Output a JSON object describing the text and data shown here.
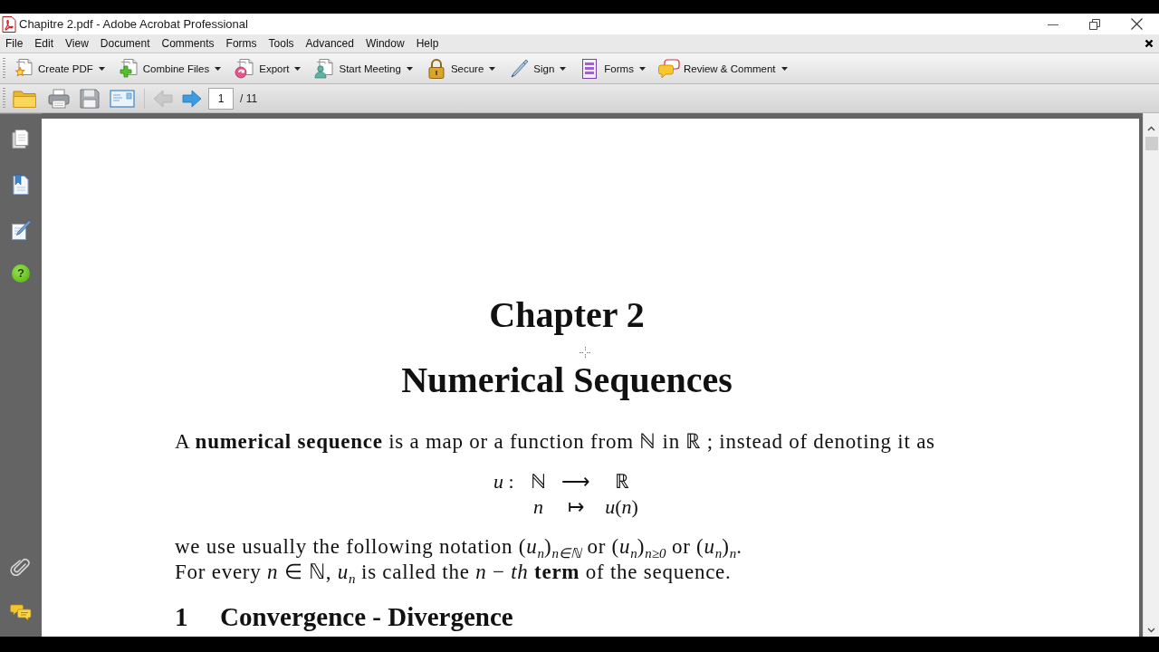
{
  "window": {
    "title": "Chapitre 2.pdf - Adobe Acrobat Professional"
  },
  "menu_bar": {
    "items": [
      "File",
      "Edit",
      "View",
      "Document",
      "Comments",
      "Forms",
      "Tools",
      "Advanced",
      "Window",
      "Help"
    ]
  },
  "tasks_toolbar": {
    "buttons": [
      {
        "kind": "create_pdf",
        "label": "Create PDF"
      },
      {
        "kind": "combine",
        "label": "Combine Files"
      },
      {
        "kind": "export",
        "label": "Export"
      },
      {
        "kind": "meeting",
        "label": "Start Meeting"
      },
      {
        "kind": "secure",
        "label": "Secure"
      },
      {
        "kind": "sign",
        "label": "Sign"
      },
      {
        "kind": "forms",
        "label": "Forms"
      },
      {
        "kind": "review",
        "label": "Review & Comment"
      }
    ]
  },
  "page_toolbar": {
    "file_buttons": [
      {
        "kind": "open"
      },
      {
        "kind": "print"
      },
      {
        "kind": "save"
      },
      {
        "kind": "email"
      }
    ],
    "page_buttons": [
      {
        "kind": "previous",
        "disabled": true
      },
      {
        "kind": "next",
        "disabled": false
      }
    ],
    "page_number": "1",
    "page_count": "/ 11"
  },
  "navigation_pane": {
    "top_buttons": [
      {
        "kind": "pages"
      },
      {
        "kind": "bookmarks"
      },
      {
        "kind": "signatures"
      },
      {
        "kind": "help",
        "glyph": "?"
      }
    ],
    "bottom_buttons": [
      {
        "kind": "attachments"
      },
      {
        "kind": "comments"
      }
    ]
  },
  "document": {
    "chapter": "Chapter 2",
    "title": "Numerical Sequences",
    "paragraph": "A **numerical sequence** is a map or a function from ℕ in ℝ ; instead of denoting it as",
    "mapping": {
      "name": "*u* :",
      "rows": [
        {
          "kind": "sets",
          "from": "ℕ",
          "arrow": "⟶",
          "to": "ℝ"
        },
        {
          "kind": "elements",
          "from": "n",
          "arrow": "↦",
          "to": "*u*(*n*)"
        }
      ]
    },
    "lines": [
      "we use usually the following notation (*u*$_{n}$)$_{n∈ℕ}$ or (*u*$_{n}$)$_{n≥0}$ or (*u*$_{n}$)$_{n}$.",
      "For every *n* ∈ ℕ, *u*$_{n}$ is called the *n* − *th* **term** of the sequence."
    ],
    "section": {
      "number": "1",
      "title": "Convergence - Divergence"
    }
  }
}
